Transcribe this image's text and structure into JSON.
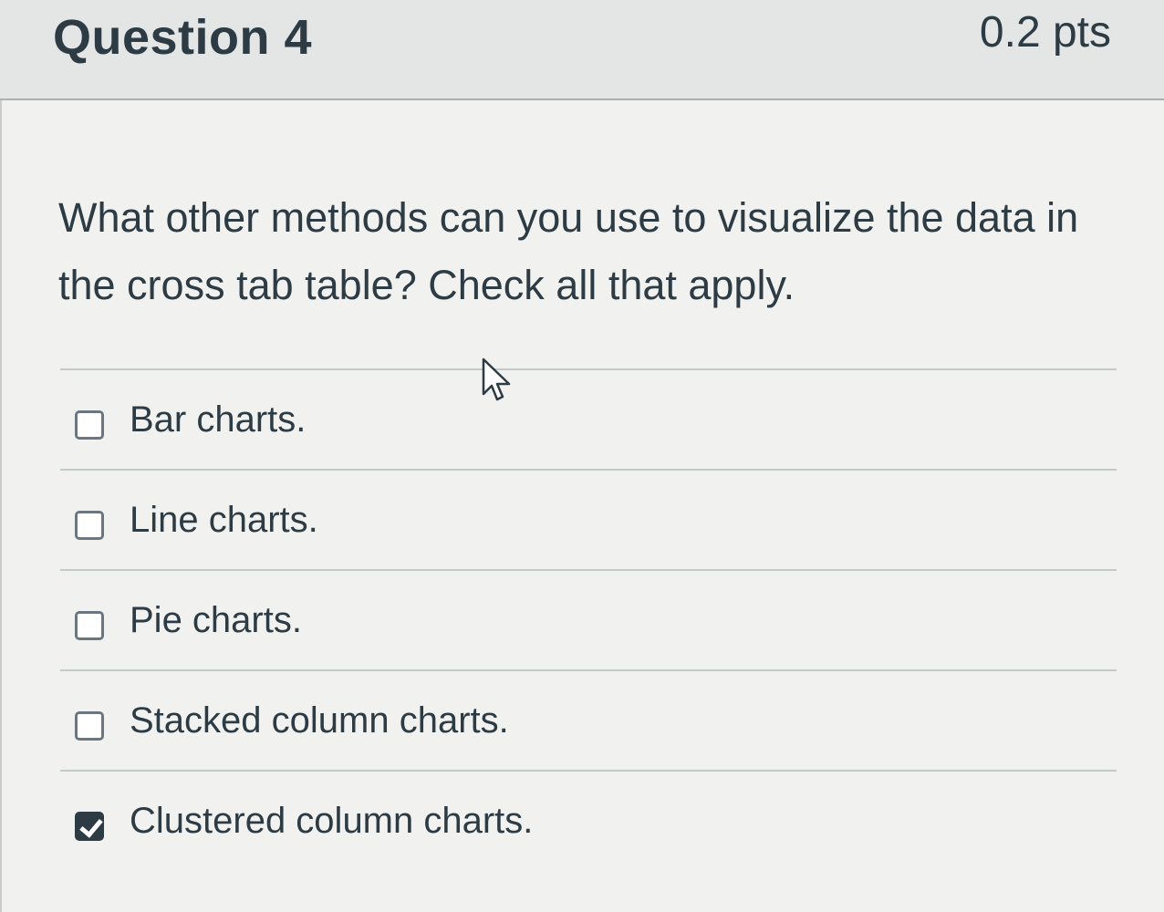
{
  "question": {
    "title": "Question 4",
    "points": "0.2 pts",
    "text": "What other methods can you use to visualize the data in the cross tab table?  Check all that apply."
  },
  "answers": [
    {
      "label": "Bar charts.",
      "checked": false
    },
    {
      "label": "Line charts.",
      "checked": false
    },
    {
      "label": "Pie charts.",
      "checked": false
    },
    {
      "label": "Stacked column charts.",
      "checked": false
    },
    {
      "label": "Clustered column charts.",
      "checked": true
    }
  ],
  "icons": {
    "cursor": "mouse-pointer-icon",
    "checkbox": "checkbox-icon"
  },
  "colors": {
    "text": "#2d3b45",
    "checked_fill": "#2d3b45"
  }
}
